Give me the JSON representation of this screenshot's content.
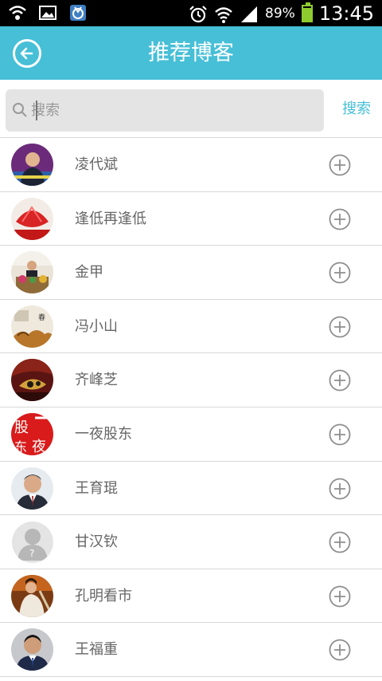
{
  "status_bar": {
    "battery_percent": "89%",
    "battery_level": 0.89,
    "time": "13:45",
    "icons": [
      "wifi-icon",
      "image-icon",
      "app-notification-icon",
      "alarm-icon",
      "wifi-signal-icon",
      "cell-signal-icon",
      "battery-icon"
    ]
  },
  "header": {
    "title": "推荐博客",
    "back_icon": "back-arrow-icon"
  },
  "search": {
    "placeholder": "搜索",
    "value": "",
    "button_label": "搜索"
  },
  "bloggers": [
    {
      "name": "凌代斌"
    },
    {
      "name": "逢低再逢低"
    },
    {
      "name": "金甲"
    },
    {
      "name": "冯小山"
    },
    {
      "name": "齐峰芝"
    },
    {
      "name": "一夜股东"
    },
    {
      "name": "王育琨"
    },
    {
      "name": "甘汉钦"
    },
    {
      "name": "孔明看市"
    },
    {
      "name": "王福重"
    }
  ],
  "colors": {
    "accent": "#46bfd7",
    "text": "#666666"
  }
}
